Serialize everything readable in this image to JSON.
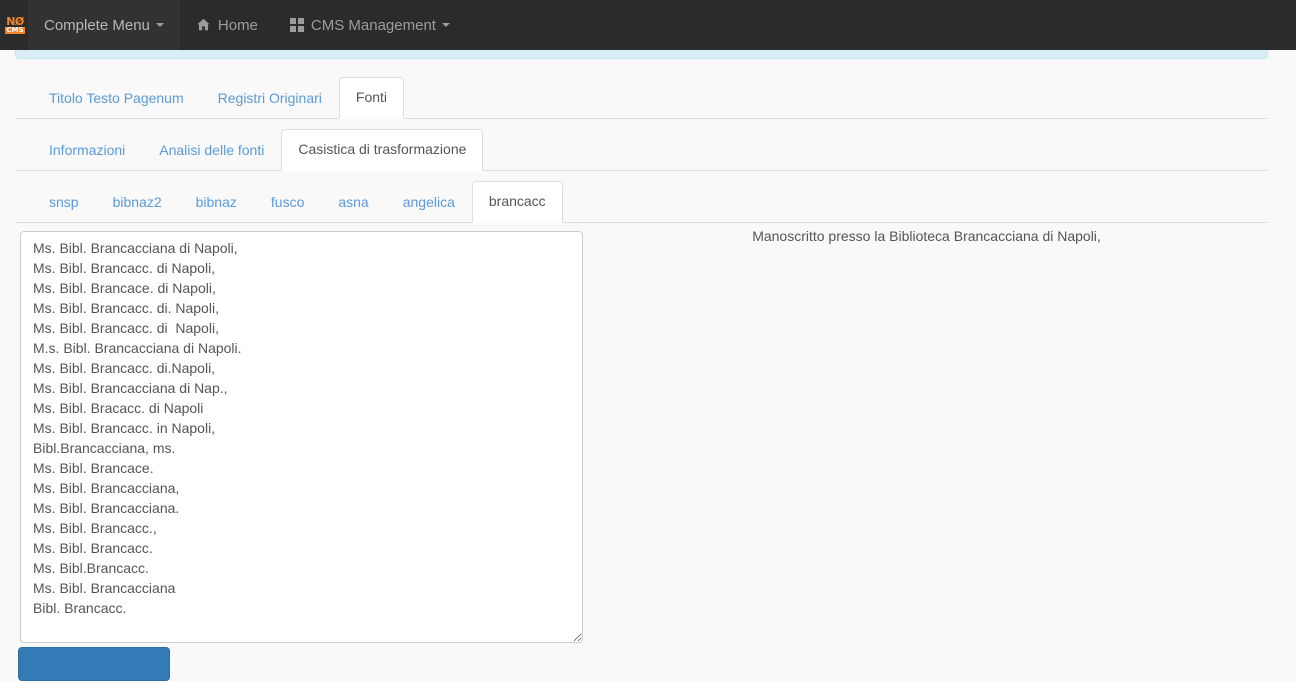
{
  "navbar": {
    "brand": {
      "logo_top": "NØ",
      "logo_bottom": "CMS"
    },
    "items": [
      {
        "label": "Complete Menu",
        "icon": "caret-down-icon",
        "active": true,
        "has_caret": true,
        "icon_left": ""
      },
      {
        "label": "Home",
        "icon": "home-icon",
        "active": false,
        "has_caret": false,
        "icon_left": "home-icon"
      },
      {
        "label": "CMS Management",
        "icon": "grid-icon",
        "active": false,
        "has_caret": true,
        "icon_left": "grid-icon"
      }
    ]
  },
  "alert": {
    "name": "info-alert-strip",
    "background": "#d9edf7",
    "border": "#bce8f1",
    "text": ""
  },
  "tabs_level1": {
    "items": [
      {
        "label": "Titolo Testo Pagenum",
        "active": false
      },
      {
        "label": "Registri Originari",
        "active": false
      },
      {
        "label": "Fonti",
        "active": true
      }
    ]
  },
  "tabs_level2": {
    "items": [
      {
        "label": "Informazioni",
        "active": false
      },
      {
        "label": "Analisi delle fonti",
        "active": false
      },
      {
        "label": "Casistica di trasformazione",
        "active": true
      }
    ]
  },
  "tabs_level3": {
    "items": [
      {
        "label": "snsp",
        "active": false
      },
      {
        "label": "bibnaz2",
        "active": false
      },
      {
        "label": "bibnaz",
        "active": false
      },
      {
        "label": "fusco",
        "active": false
      },
      {
        "label": "asna",
        "active": false
      },
      {
        "label": "angelica",
        "active": false
      },
      {
        "label": "brancacc",
        "active": true
      }
    ]
  },
  "main": {
    "cases_textarea": {
      "value": "Ms. Bibl. Brancacciana di Napoli,\nMs. Bibl. Brancacc. di Napoli,\nMs. Bibl. Brancace. di Napoli,\nMs. Bibl. Brancacc. di. Napoli,\nMs. Bibl. Brancacc. di  Napoli,\nM.s. Bibl. Brancacciana di Napoli.\nMs. Bibl. Brancacc. di.Napoli,\nMs. Bibl. Brancacciana di Nap.,\nMs. Bibl. Bracacc. di Napoli\nMs. Bibl. Brancacc. in Napoli,\nBibl.Brancacciana, ms.\nMs. Bibl. Brancace.\nMs. Bibl. Brancacciana,\nMs. Bibl. Brancacciana.\nMs. Bibl. Brancacc.,\nMs. Bibl. Brancacc.\nMs. Bibl.Brancacc.\nMs. Bibl. Brancacciana\nBibl. Brancacc.",
      "placeholder": ""
    },
    "resolved_label": "Manoscritto presso la Biblioteca Brancacciana di Napoli,"
  },
  "footer": {
    "submit_label": ""
  },
  "colors": {
    "navbar_bg": "#2b2b2b",
    "navbar_text": "#9d9d9d",
    "brand_orange": "#f0862b",
    "tab_link": "#5b9bd5",
    "tab_active_text": "#555555",
    "page_bg": "#f9f9f9",
    "alert_bg": "#d9edf7",
    "primary_button": "#337ab7"
  }
}
